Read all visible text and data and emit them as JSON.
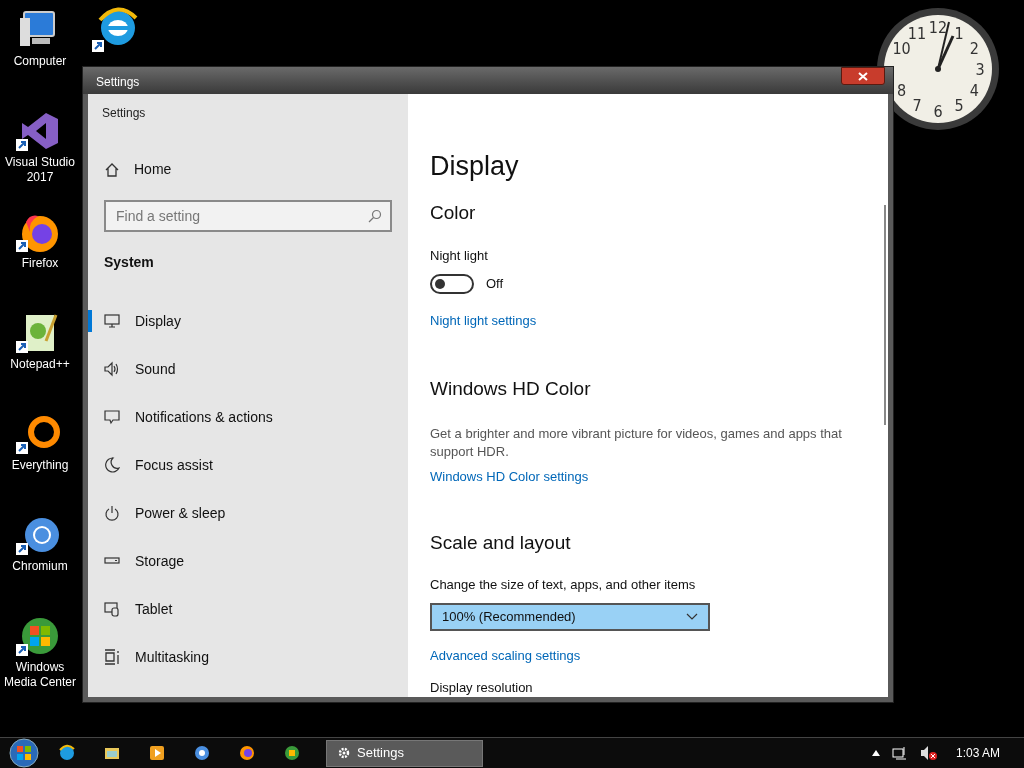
{
  "desktop_icons": [
    {
      "label": "Computer",
      "kind": "computer"
    },
    {
      "label": "Visual Studio\n2017",
      "kind": "vs"
    },
    {
      "label": "Firefox",
      "kind": "firefox"
    },
    {
      "label": "Notepad++",
      "kind": "notepad"
    },
    {
      "label": "Everything",
      "kind": "everything"
    },
    {
      "label": "Chromium",
      "kind": "chromium"
    },
    {
      "label": "Windows\nMedia Center",
      "kind": "wmc"
    }
  ],
  "clock": {
    "numerals": [
      "12",
      "1",
      "2",
      "3",
      "4",
      "5",
      "6",
      "7",
      "8",
      "10",
      "11"
    ]
  },
  "window": {
    "title": "Settings",
    "app_title": "Settings",
    "sidebar": {
      "home": "Home",
      "search": {
        "placeholder": "Find a setting"
      },
      "section": "System",
      "items": [
        {
          "label": "Display",
          "selected": true
        },
        {
          "label": "Sound",
          "selected": false
        },
        {
          "label": "Notifications & actions",
          "selected": false
        },
        {
          "label": "Focus assist",
          "selected": false
        },
        {
          "label": "Power & sleep",
          "selected": false
        },
        {
          "label": "Storage",
          "selected": false
        },
        {
          "label": "Tablet",
          "selected": false
        },
        {
          "label": "Multitasking",
          "selected": false
        }
      ]
    },
    "content": {
      "heading": "Display",
      "color": {
        "heading": "Color",
        "night_light": {
          "label": "Night light",
          "on": false,
          "state": "Off"
        },
        "link": "Night light settings"
      },
      "hd_color": {
        "heading": "Windows HD Color",
        "description": "Get a brighter and more vibrant picture for videos, games and apps that support HDR.",
        "link": "Windows HD Color settings"
      },
      "scale": {
        "heading": "Scale and layout",
        "label": "Change the size of text, apps, and other items",
        "dropdown": "100% (Recommended)",
        "link": "Advanced scaling settings",
        "next_label": "Display resolution"
      }
    }
  },
  "taskbar": {
    "task": {
      "label": "Settings",
      "selected": true
    },
    "time": "1:03 AM"
  }
}
